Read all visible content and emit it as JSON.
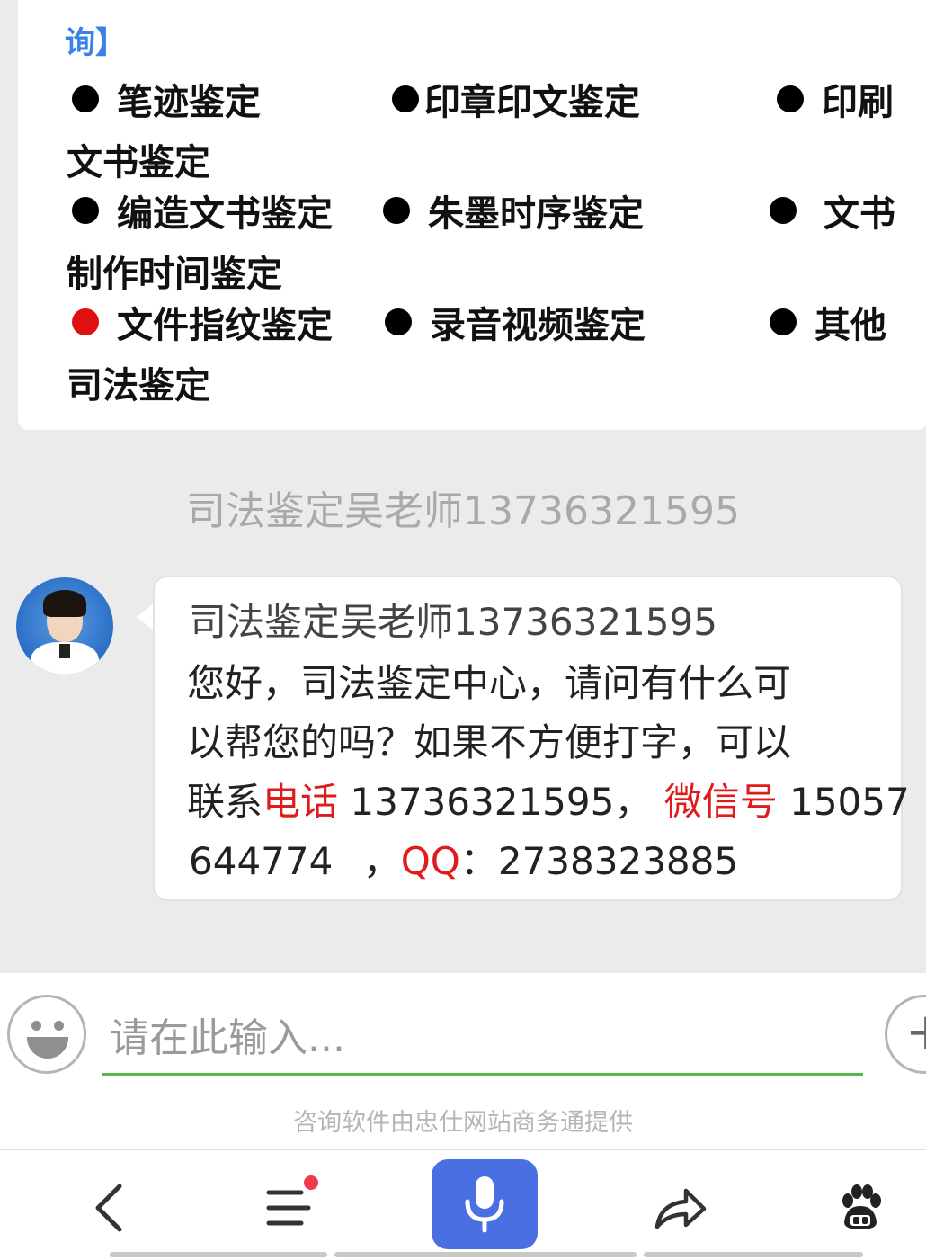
{
  "service_card": {
    "heading": "询】",
    "rows": [
      {
        "col1": "笔迹鉴定",
        "col2": "印章印文鉴定",
        "col3": "印刷",
        "wrap": "文书鉴定"
      },
      {
        "col1": "编造文书鉴定",
        "col2": "朱墨时序鉴定",
        "col3": "文书",
        "wrap": "制作时间鉴定"
      },
      {
        "col1": "文件指纹鉴定",
        "col2": "录音视频鉴定",
        "col3": "其他",
        "wrap": "司法鉴定"
      }
    ]
  },
  "chat": {
    "agent_name": "司法鉴定吴老师13736321595",
    "message": {
      "sender": "司法鉴定吴老师13736321595",
      "line1": "您好，司法鉴定中心，请问有什么可",
      "line2": "以帮您的吗？如果不方便打字，可以",
      "line3_prefix": "联系",
      "phone_label": "电话",
      "phone": "13736321595",
      "sep1": "，",
      "wechat_label": "微信号",
      "wechat_part1": "15057",
      "wechat_part2": "644774",
      "sep2": "，",
      "qq_label": "QQ",
      "qq_colon": "：",
      "qq": "2738323885"
    }
  },
  "input_bar": {
    "placeholder": "请在此输入...",
    "plus": "+",
    "powered_by": "咨询软件由忠仕网站商务通提供"
  },
  "colors": {
    "highlight": "#e01b1b",
    "accent_blue": "#4a6fe3",
    "input_underline": "#54b84a",
    "heading_blue": "#3a82e8"
  },
  "toolbar": {
    "icons": [
      "back-icon",
      "menu-icon",
      "microphone-icon",
      "share-icon",
      "baidu-paw-icon"
    ]
  }
}
